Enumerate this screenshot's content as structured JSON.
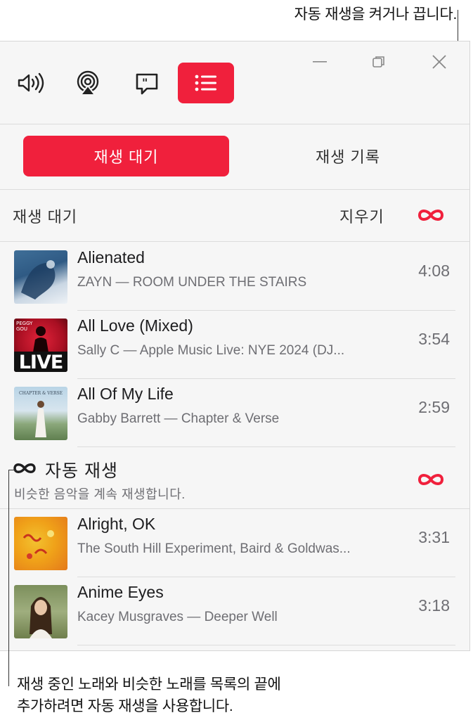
{
  "callouts": {
    "top": "자동 재생을 켜거나 끕니다.",
    "bottom_line1": "재생 중인 노래와 비슷한 노래를 목록의 끝에",
    "bottom_line2": "추가하려면 자동 재생을 사용합니다."
  },
  "toolbar": {
    "icons": [
      "volume-icon",
      "airplay-icon",
      "lyrics-icon",
      "queue-list-icon"
    ],
    "active": "queue-list-icon"
  },
  "tabs": [
    {
      "label": "재생 대기",
      "active": true
    },
    {
      "label": "재생 기록",
      "active": false
    }
  ],
  "queue": {
    "label": "재생 대기",
    "clear_label": "지우기",
    "tracks": [
      {
        "title": "Alienated",
        "subtitle": "ZAYN — ROOM UNDER THE STAIRS",
        "duration": "4:08"
      },
      {
        "title": "All Love (Mixed)",
        "subtitle": "Sally C — Apple Music Live: NYE 2024 (DJ...",
        "duration": "3:54"
      },
      {
        "title": "All Of My Life",
        "subtitle": "Gabby Barrett — Chapter & Verse",
        "duration": "2:59"
      }
    ]
  },
  "autoplay": {
    "title": "자동 재생",
    "description": "비슷한 음악을 계속 재생합니다.",
    "tracks": [
      {
        "title": "Alright, OK",
        "subtitle": "The South Hill Experiment, Baird & Goldwas...",
        "duration": "3:31"
      },
      {
        "title": "Anime Eyes",
        "subtitle": "Kacey Musgraves — Deeper Well",
        "duration": "3:18"
      }
    ]
  },
  "art_text": {
    "live": "LIVE",
    "peggy": "PEGGY GOU",
    "chapter": "CHAPTER & VERSE"
  },
  "colors": {
    "accent": "#f0203c"
  }
}
